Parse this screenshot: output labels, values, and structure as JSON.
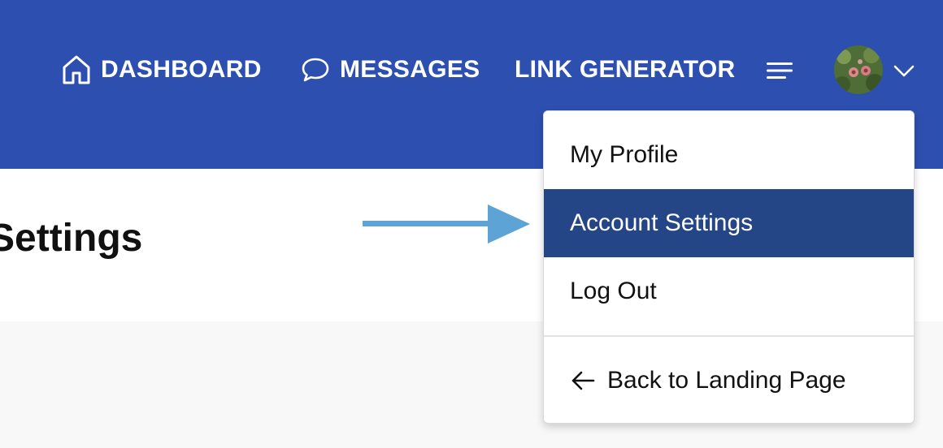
{
  "nav": {
    "dashboard_label": "DASHBOARD",
    "dashboard_icon": "home-icon",
    "messages_label": "MESSAGES",
    "messages_icon": "chat-bubble-icon",
    "link_generator_label": "LINK GENERATOR",
    "menu_icon": "hamburger-icon",
    "avatar_icon": "user-avatar",
    "dropdown_icon": "chevron-down-icon"
  },
  "page": {
    "title": "Settings"
  },
  "dropdown": {
    "items": [
      {
        "label": "My Profile"
      },
      {
        "label": "Account Settings",
        "selected": true
      },
      {
        "label": "Log Out"
      }
    ],
    "back_label": "Back to Landing Page",
    "back_icon": "arrow-left-icon"
  },
  "colors": {
    "header_bg": "#2d4faf",
    "selected_item_bg": "#244586",
    "annotation_arrow": "#5ea3d6",
    "page_bg": "#f8f8f8"
  }
}
